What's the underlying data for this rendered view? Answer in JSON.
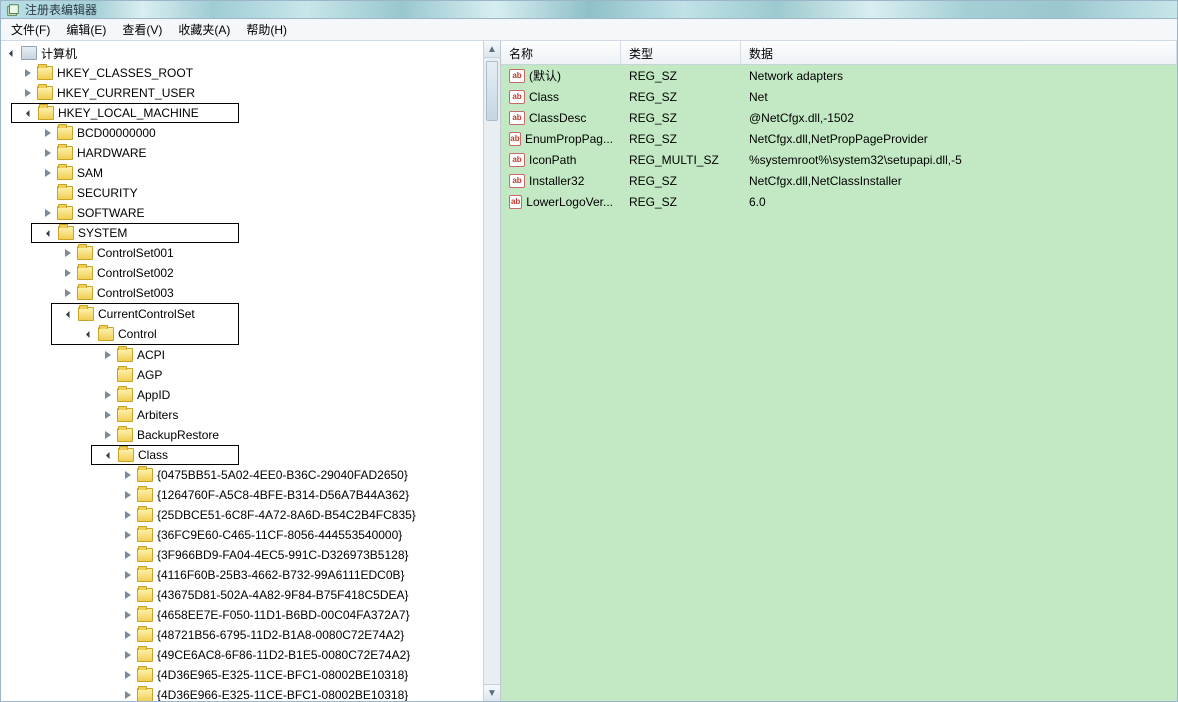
{
  "app": {
    "title": "注册表编辑器"
  },
  "menu": {
    "file": "文件(F)",
    "edit": "编辑(E)",
    "view": "查看(V)",
    "favorites": "收藏夹(A)",
    "help": "帮助(H)"
  },
  "tree": {
    "root": "计算机",
    "hkcr": "HKEY_CLASSES_ROOT",
    "hkcu": "HKEY_CURRENT_USER",
    "hklm": "HKEY_LOCAL_MACHINE",
    "hklm_children": {
      "bcd": "BCD00000000",
      "hardware": "HARDWARE",
      "sam": "SAM",
      "security": "SECURITY",
      "software": "SOFTWARE",
      "system": "SYSTEM"
    },
    "system_children": {
      "cs1": "ControlSet001",
      "cs2": "ControlSet002",
      "cs3": "ControlSet003",
      "ccs": "CurrentControlSet"
    },
    "ccs_children": {
      "control": "Control"
    },
    "control_children": {
      "acpi": "ACPI",
      "agp": "AGP",
      "appid": "AppID",
      "arbiters": "Arbiters",
      "backuprestore": "BackupRestore",
      "class": "Class"
    },
    "class_children": [
      "{0475BB51-5A02-4EE0-B36C-29040FAD2650}",
      "{1264760F-A5C8-4BFE-B314-D56A7B44A362}",
      "{25DBCE51-6C8F-4A72-8A6D-B54C2B4FC835}",
      "{36FC9E60-C465-11CF-8056-444553540000}",
      "{3F966BD9-FA04-4EC5-991C-D326973B5128}",
      "{4116F60B-25B3-4662-B732-99A6111EDC0B}",
      "{43675D81-502A-4A82-9F84-B75F418C5DEA}",
      "{4658EE7E-F050-11D1-B6BD-00C04FA372A7}",
      "{48721B56-6795-11D2-B1A8-0080C72E74A2}",
      "{49CE6AC8-6F86-11D2-B1E5-0080C72E74A2}",
      "{4D36E965-E325-11CE-BFC1-08002BE10318}",
      "{4D36E966-E325-11CE-BFC1-08002BE10318}"
    ]
  },
  "list": {
    "headers": {
      "name": "名称",
      "type": "类型",
      "data": "数据"
    },
    "rows": [
      {
        "name": "(默认)",
        "type": "REG_SZ",
        "data": "Network adapters"
      },
      {
        "name": "Class",
        "type": "REG_SZ",
        "data": "Net"
      },
      {
        "name": "ClassDesc",
        "type": "REG_SZ",
        "data": "@NetCfgx.dll,-1502"
      },
      {
        "name": "EnumPropPag...",
        "type": "REG_SZ",
        "data": "NetCfgx.dll,NetPropPageProvider"
      },
      {
        "name": "IconPath",
        "type": "REG_MULTI_SZ",
        "data": "%systemroot%\\system32\\setupapi.dll,-5"
      },
      {
        "name": "Installer32",
        "type": "REG_SZ",
        "data": "NetCfgx.dll,NetClassInstaller"
      },
      {
        "name": "LowerLogoVer...",
        "type": "REG_SZ",
        "data": "6.0"
      }
    ]
  }
}
